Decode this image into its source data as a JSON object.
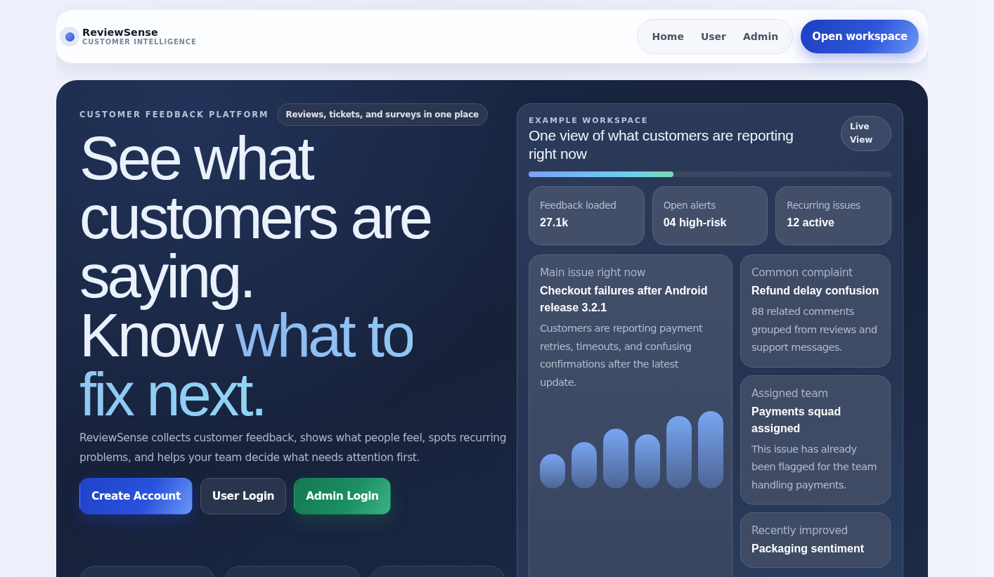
{
  "brand": {
    "name": "ReviewSense",
    "tagline": "CUSTOMER INTELLIGENCE"
  },
  "nav": {
    "links": [
      {
        "label": "Home"
      },
      {
        "label": "User"
      },
      {
        "label": "Admin"
      }
    ],
    "cta": "Open workspace"
  },
  "hero": {
    "eyebrow": "CUSTOMER FEEDBACK PLATFORM",
    "pill": "Reviews, tickets, and surveys in one place",
    "headline": [
      {
        "text": "See what customers are saying.",
        "accent": false
      },
      {
        "text": "Know ",
        "accent": false
      },
      {
        "text": "what to fix next.",
        "accent": true
      }
    ],
    "description": "ReviewSense collects customer feedback, shows what people feel, spots recurring problems, and helps your team decide what needs attention first.",
    "buttons": [
      {
        "label": "Create Account",
        "kind": "primary"
      },
      {
        "label": "User Login",
        "kind": "secondary"
      },
      {
        "label": "Admin Login",
        "kind": "success"
      }
    ]
  },
  "workspace": {
    "eyebrow": "EXAMPLE WORKSPACE",
    "title": "One view of what customers are reporting right now",
    "badge": "Live View",
    "progress": {
      "level": 0.4
    },
    "stats": [
      {
        "label": "Feedback loaded",
        "value": "27.1k"
      },
      {
        "label": "Open alerts",
        "value": "04 high-risk"
      },
      {
        "label": "Recurring issues",
        "value": "12 active"
      }
    ],
    "main_issue": {
      "label": "Main issue right now",
      "title": "Checkout failures after Android release 3.2.1",
      "text": "Customers are reporting payment retries, timeouts, and confusing confirmations after the latest update."
    },
    "side_cards": [
      {
        "label": "Common complaint",
        "title": "Refund delay confusion",
        "text": "88 related comments grouped from reviews and support messages."
      },
      {
        "label": "Assigned team",
        "title": "Payments squad assigned",
        "text": "This issue has already been flagged for the team handling payments."
      },
      {
        "label": "Recently improved",
        "title": "Packaging sentiment"
      }
    ]
  }
}
